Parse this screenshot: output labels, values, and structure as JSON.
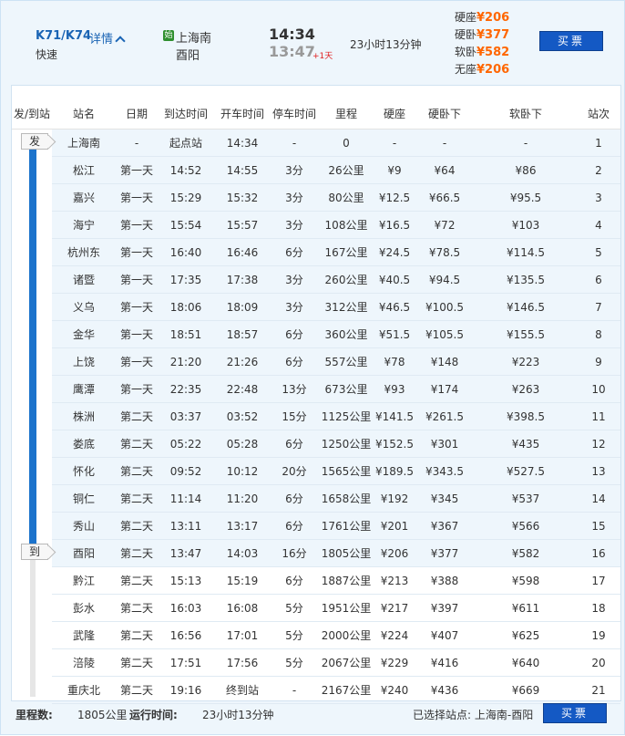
{
  "train": {
    "number": "K71/K74",
    "detail_label": "详情",
    "type": "快速",
    "start_badge": "始",
    "from_station": "上海南",
    "to_station": "酉阳",
    "depart_time": "14:34",
    "arrive_time": "13:47",
    "plus_day": "+1天",
    "duration": "23小时13分钟",
    "buy_label": "买票"
  },
  "prices": [
    {
      "seat": "硬座",
      "price": "¥206"
    },
    {
      "seat": "硬卧",
      "price": "¥377"
    },
    {
      "seat": "软卧",
      "price": "¥582"
    },
    {
      "seat": "无座",
      "price": "¥206"
    }
  ],
  "table": {
    "columns": [
      "发/到站",
      "站名",
      "日期",
      "到达时间",
      "开车时间",
      "停车时间",
      "里程",
      "硬座",
      "硬卧下",
      "软卧下",
      "站次"
    ],
    "depart_flag": "发",
    "arrive_flag": "到",
    "rows": [
      [
        "上海南",
        "-",
        "起点站",
        "14:34",
        "-",
        "0",
        "-",
        "-",
        "-",
        "1"
      ],
      [
        "松江",
        "第一天",
        "14:52",
        "14:55",
        "3分",
        "26公里",
        "¥9",
        "¥64",
        "¥86",
        "2"
      ],
      [
        "嘉兴",
        "第一天",
        "15:29",
        "15:32",
        "3分",
        "80公里",
        "¥12.5",
        "¥66.5",
        "¥95.5",
        "3"
      ],
      [
        "海宁",
        "第一天",
        "15:54",
        "15:57",
        "3分",
        "108公里",
        "¥16.5",
        "¥72",
        "¥103",
        "4"
      ],
      [
        "杭州东",
        "第一天",
        "16:40",
        "16:46",
        "6分",
        "167公里",
        "¥24.5",
        "¥78.5",
        "¥114.5",
        "5"
      ],
      [
        "诸暨",
        "第一天",
        "17:35",
        "17:38",
        "3分",
        "260公里",
        "¥40.5",
        "¥94.5",
        "¥135.5",
        "6"
      ],
      [
        "义乌",
        "第一天",
        "18:06",
        "18:09",
        "3分",
        "312公里",
        "¥46.5",
        "¥100.5",
        "¥146.5",
        "7"
      ],
      [
        "金华",
        "第一天",
        "18:51",
        "18:57",
        "6分",
        "360公里",
        "¥51.5",
        "¥105.5",
        "¥155.5",
        "8"
      ],
      [
        "上饶",
        "第一天",
        "21:20",
        "21:26",
        "6分",
        "557公里",
        "¥78",
        "¥148",
        "¥223",
        "9"
      ],
      [
        "鹰潭",
        "第一天",
        "22:35",
        "22:48",
        "13分",
        "673公里",
        "¥93",
        "¥174",
        "¥263",
        "10"
      ],
      [
        "株洲",
        "第二天",
        "03:37",
        "03:52",
        "15分",
        "1125公里",
        "¥141.5",
        "¥261.5",
        "¥398.5",
        "11"
      ],
      [
        "娄底",
        "第二天",
        "05:22",
        "05:28",
        "6分",
        "1250公里",
        "¥152.5",
        "¥301",
        "¥435",
        "12"
      ],
      [
        "怀化",
        "第二天",
        "09:52",
        "10:12",
        "20分",
        "1565公里",
        "¥189.5",
        "¥343.5",
        "¥527.5",
        "13"
      ],
      [
        "铜仁",
        "第二天",
        "11:14",
        "11:20",
        "6分",
        "1658公里",
        "¥192",
        "¥345",
        "¥537",
        "14"
      ],
      [
        "秀山",
        "第二天",
        "13:11",
        "13:17",
        "6分",
        "1761公里",
        "¥201",
        "¥367",
        "¥566",
        "15"
      ],
      [
        "酉阳",
        "第二天",
        "13:47",
        "14:03",
        "16分",
        "1805公里",
        "¥206",
        "¥377",
        "¥582",
        "16"
      ],
      [
        "黔江",
        "第二天",
        "15:13",
        "15:19",
        "6分",
        "1887公里",
        "¥213",
        "¥388",
        "¥598",
        "17"
      ],
      [
        "彭水",
        "第二天",
        "16:03",
        "16:08",
        "5分",
        "1951公里",
        "¥217",
        "¥397",
        "¥611",
        "18"
      ],
      [
        "武隆",
        "第二天",
        "16:56",
        "17:01",
        "5分",
        "2000公里",
        "¥224",
        "¥407",
        "¥625",
        "19"
      ],
      [
        "涪陵",
        "第二天",
        "17:51",
        "17:56",
        "5分",
        "2067公里",
        "¥229",
        "¥416",
        "¥640",
        "20"
      ],
      [
        "重庆北",
        "第二天",
        "19:16",
        "终到站",
        "-",
        "2167公里",
        "¥240",
        "¥436",
        "¥669",
        "21"
      ]
    ]
  },
  "footer": {
    "distance_label": "里程数:",
    "distance_value": "1805公里",
    "runtime_label": "运行时间:",
    "runtime_value": "23小时13分钟",
    "selected_label": "已选择站点: 上海南-酉阳",
    "buy_label": "买票"
  }
}
